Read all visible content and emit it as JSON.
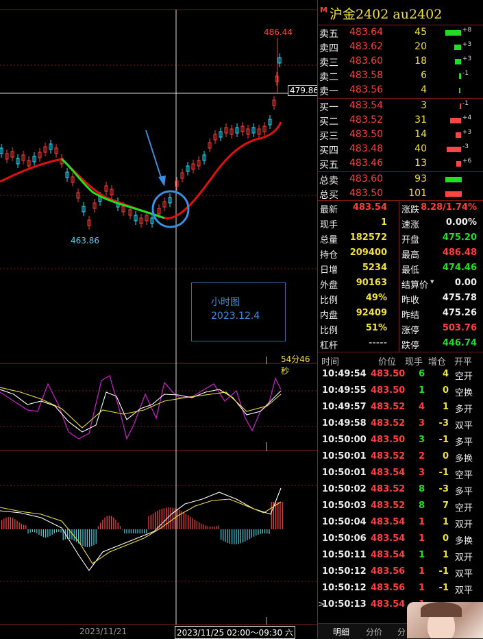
{
  "header": {
    "flag": "M",
    "title": "沪金2402 au2402"
  },
  "chart": {
    "price_high_label": "486.44",
    "price_low_label": "463.86",
    "crosshair_price": "479.86",
    "countdown": "54分46秒",
    "annotation": {
      "line1": "小时图",
      "line2": "2023.12.4"
    },
    "date_left": "2023/11/21",
    "date_crosshair": "2023/11/25 02:00～09:30 六"
  },
  "orderbook": {
    "asks": [
      {
        "label": "卖五",
        "price": "483.64",
        "vol": "45",
        "chg": "+8",
        "bar": 0.9,
        "barcolor": "#22dd22"
      },
      {
        "label": "卖四",
        "price": "483.62",
        "vol": "20",
        "chg": "+3",
        "bar": 0.4,
        "barcolor": "#22dd22"
      },
      {
        "label": "卖三",
        "price": "483.60",
        "vol": "18",
        "chg": "+3",
        "bar": 0.35,
        "barcolor": "#22dd22"
      },
      {
        "label": "卖二",
        "price": "483.58",
        "vol": "6",
        "chg": "-1",
        "bar": 0.12,
        "barcolor": "#22dd22"
      },
      {
        "label": "卖一",
        "price": "483.56",
        "vol": "4",
        "chg": "",
        "bar": 0.08,
        "barcolor": "#22dd22"
      }
    ],
    "bids": [
      {
        "label": "买一",
        "price": "483.54",
        "vol": "3",
        "chg": "-1",
        "bar": 0.06,
        "barcolor": "#ff4444"
      },
      {
        "label": "买二",
        "price": "483.52",
        "vol": "31",
        "chg": "+4",
        "bar": 0.6,
        "barcolor": "#ff4444"
      },
      {
        "label": "买三",
        "price": "483.50",
        "vol": "14",
        "chg": "+3",
        "bar": 0.3,
        "barcolor": "#ff4444"
      },
      {
        "label": "买四",
        "price": "483.48",
        "vol": "40",
        "chg": "-3",
        "bar": 0.8,
        "barcolor": "#ff4444"
      },
      {
        "label": "买五",
        "price": "483.46",
        "vol": "13",
        "chg": "+6",
        "bar": 0.28,
        "barcolor": "#ff4444"
      }
    ],
    "totals": [
      {
        "label": "总卖",
        "price": "483.60",
        "vol": "93",
        "barcolor": "#22dd22"
      },
      {
        "label": "总买",
        "price": "483.50",
        "vol": "101",
        "barcolor": "#ff4444"
      }
    ]
  },
  "stats": [
    {
      "l1": "最新",
      "v1": "483.54",
      "c1": "red",
      "l2": "涨跌",
      "v2": "8.28/1.74%",
      "c2": "red"
    },
    {
      "l1": "现手",
      "v1": "1",
      "c1": "yellow",
      "l2": "速涨",
      "v2": "0.00%",
      "c2": "white"
    },
    {
      "l1": "总量",
      "v1": "182572",
      "c1": "yellow",
      "l2": "开盘",
      "v2": "475.20",
      "c2": "green"
    },
    {
      "l1": "持仓",
      "v1": "209400",
      "c1": "yellow",
      "l2": "最高",
      "v2": "486.48",
      "c2": "red"
    },
    {
      "l1": "日增",
      "v1": "5234",
      "c1": "yellow",
      "l2": "最低",
      "v2": "474.46",
      "c2": "green"
    },
    {
      "l1": "外盘",
      "v1": "90163",
      "c1": "yellow",
      "l2": "结算价",
      "v2": "0.00",
      "c2": "white"
    },
    {
      "l1": "比例",
      "v1": "49%",
      "c1": "yellow",
      "l2": "昨收",
      "v2": "475.78",
      "c2": "white"
    },
    {
      "l1": "内盘",
      "v1": "92409",
      "c1": "yellow",
      "l2": "昨结",
      "v2": "475.26",
      "c2": "white"
    },
    {
      "l1": "比例",
      "v1": "51%",
      "c1": "yellow",
      "l2": "涨停",
      "v2": "503.76",
      "c2": "red"
    },
    {
      "l1": "杠杆",
      "v1": "-----",
      "c1": "grey",
      "l2": "跌停",
      "v2": "446.74",
      "c2": "green"
    }
  ],
  "ticks_header": {
    "time": "时间",
    "price": "价位",
    "vol": "现手",
    "oi": "增仓",
    "type": "开平"
  },
  "ticks": [
    {
      "time": "10:49:54",
      "price": "483.50",
      "vol": "6",
      "vc": "green",
      "oi": "4",
      "type": "空开"
    },
    {
      "time": "10:49:55",
      "price": "483.50",
      "vol": "1",
      "vc": "green",
      "oi": "0",
      "type": "空换"
    },
    {
      "time": "10:49:57",
      "price": "483.52",
      "vol": "4",
      "vc": "red",
      "oi": "1",
      "type": "多开"
    },
    {
      "time": "10:49:58",
      "price": "483.52",
      "vol": "3",
      "vc": "red",
      "oi": "-3",
      "type": "双平"
    },
    {
      "time": "10:50:00",
      "price": "483.50",
      "vol": "3",
      "vc": "green",
      "oi": "-1",
      "type": "多平"
    },
    {
      "time": "10:50:01",
      "price": "483.52",
      "vol": "2",
      "vc": "red",
      "oi": "0",
      "type": "多换"
    },
    {
      "time": "10:50:01",
      "price": "483.54",
      "vol": "3",
      "vc": "red",
      "oi": "-1",
      "type": "空平"
    },
    {
      "time": "10:50:02",
      "price": "483.52",
      "vol": "8",
      "vc": "green",
      "oi": "-3",
      "type": "多平"
    },
    {
      "time": "10:50:03",
      "price": "483.52",
      "vol": "8",
      "vc": "green",
      "oi": "7",
      "type": "空开"
    },
    {
      "time": "10:50:04",
      "price": "483.54",
      "vol": "1",
      "vc": "red",
      "oi": "1",
      "type": "双开"
    },
    {
      "time": "10:50:06",
      "price": "483.54",
      "vol": "1",
      "vc": "red",
      "oi": "0",
      "type": "多换"
    },
    {
      "time": "10:50:11",
      "price": "483.54",
      "vol": "1",
      "vc": "green",
      "oi": "1",
      "type": "双开"
    },
    {
      "time": "10:50:12",
      "price": "483.56",
      "vol": "1",
      "vc": "red",
      "oi": "-1",
      "type": "双平"
    },
    {
      "time": "10:50:12",
      "price": "483.56",
      "vol": "1",
      "vc": "red",
      "oi": "-1",
      "type": "双平"
    },
    {
      "time": "10:50:13",
      "price": "483.54",
      "vol": "1",
      "vc": "red",
      "oi": "",
      "type": ""
    }
  ],
  "tabs": {
    "t1": "明细",
    "t2": "分价",
    "t3": "分"
  }
}
